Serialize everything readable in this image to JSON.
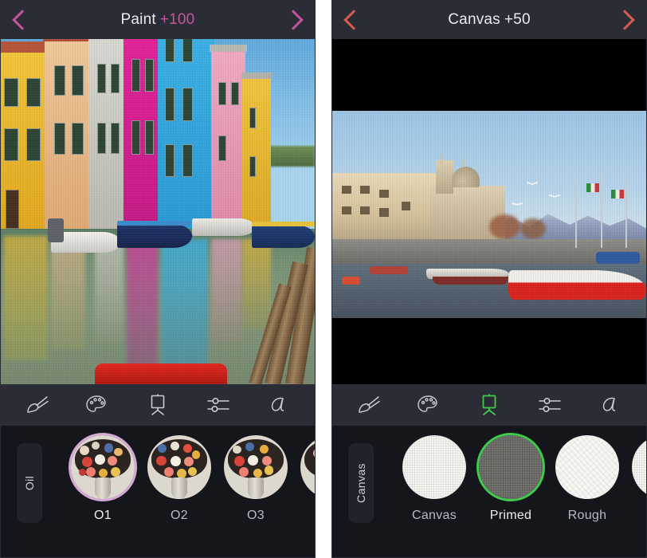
{
  "left_panel": {
    "header": {
      "back_icon": "chevron-left-icon",
      "forward_icon": "chevron-right-icon",
      "title": "Paint",
      "badge": "+100",
      "accent": "#c4549d",
      "title_color": "#e9eaee",
      "bg": "#2b2d36"
    },
    "artwork": {
      "name": "burano-canal-painting",
      "description": "Colorful Burano canal houses reflected in green water with moored boats"
    },
    "toolbar": {
      "items": [
        {
          "icon": "brush-icon",
          "label": "Brush",
          "active": false
        },
        {
          "icon": "palette-icon",
          "label": "Palette",
          "active": false
        },
        {
          "icon": "easel-icon",
          "label": "Canvas",
          "active": false
        },
        {
          "icon": "sliders-icon",
          "label": "Adjust",
          "active": false
        },
        {
          "icon": "text-a-icon",
          "label": "Text",
          "active": false
        }
      ]
    },
    "tray": {
      "category": "Oil",
      "selection_color": "#d5a8d8",
      "presets": [
        {
          "label": "O1",
          "selected": true
        },
        {
          "label": "O2",
          "selected": false
        },
        {
          "label": "O3",
          "selected": false
        },
        {
          "label": "",
          "selected": false
        }
      ]
    }
  },
  "right_panel": {
    "header": {
      "back_icon": "chevron-left-icon",
      "forward_icon": "chevron-right-icon",
      "title": "Canvas",
      "badge": "+50",
      "accent": "#d95a50",
      "title_color": "#e9eaee",
      "bg": "#2b2d36"
    },
    "artwork": {
      "name": "lakeside-harbour-painting",
      "description": "Italian lakeside harbour with church, snow mountains, flags and a red boat; letterboxed with black bars"
    },
    "toolbar": {
      "items": [
        {
          "icon": "brush-icon",
          "label": "Brush",
          "active": false
        },
        {
          "icon": "palette-icon",
          "label": "Palette",
          "active": false
        },
        {
          "icon": "easel-icon",
          "label": "Canvas",
          "active": true
        },
        {
          "icon": "sliders-icon",
          "label": "Adjust",
          "active": false
        },
        {
          "icon": "text-a-icon",
          "label": "Text",
          "active": false
        }
      ],
      "active_color": "#3ecb4a"
    },
    "tray": {
      "category": "Canvas",
      "selection_color": "#3ecb4a",
      "presets": [
        {
          "label": "Canvas",
          "selected": false,
          "texture": "plain"
        },
        {
          "label": "Primed",
          "selected": true,
          "texture": "primed"
        },
        {
          "label": "Rough",
          "selected": false,
          "texture": "rough"
        },
        {
          "label": "",
          "selected": false,
          "texture": "plain"
        }
      ]
    }
  }
}
